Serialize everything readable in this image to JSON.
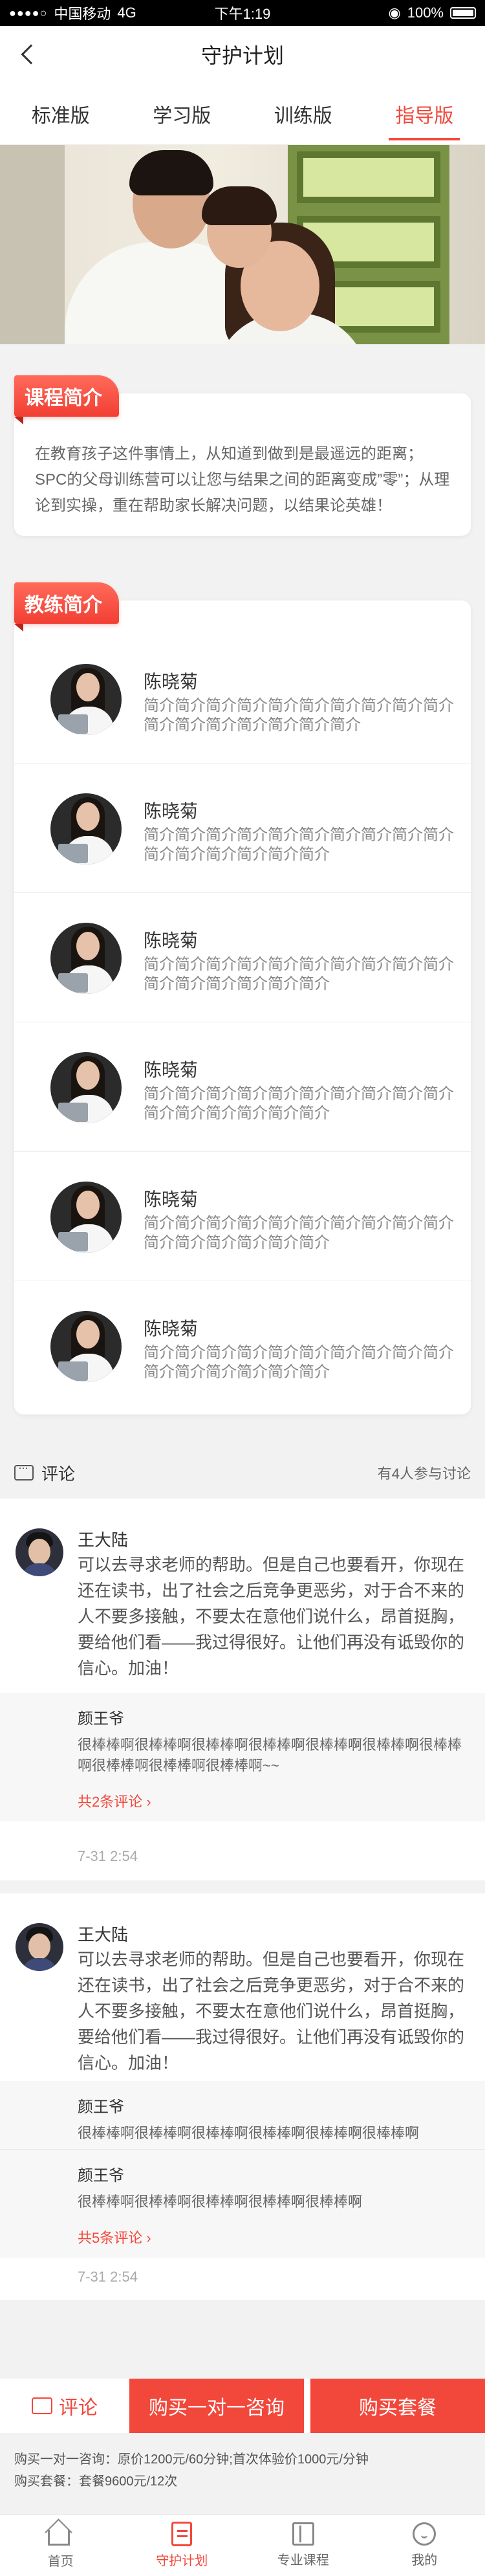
{
  "status_bar": {
    "carrier": "中国移动",
    "network": "4G",
    "time": "下午1:19",
    "battery": "100%"
  },
  "nav": {
    "title": "守护计划"
  },
  "tabs": [
    {
      "label": "标准版"
    },
    {
      "label": "学习版"
    },
    {
      "label": "训练版"
    },
    {
      "label": "指导版",
      "active": true
    }
  ],
  "course_intro": {
    "heading": "课程简介",
    "text": "在教育孩子这件事情上，从知道到做到是最遥远的距离；SPC的父母训练营可以让您与结果之间的距离变成”零”；从理论到实操，重在帮助家长解决问题，以结果论英雄！"
  },
  "coach_intro": {
    "heading": "教练简介",
    "coaches": [
      {
        "name": "陈晓菊",
        "desc": "简介简介简介简介简介简介简介简介简介简介简介简介简介简介简介简介简介"
      },
      {
        "name": "陈晓菊",
        "desc": "简介简介简介简介简介简介简介简介简介简介简介简介简介简介简介简介"
      },
      {
        "name": "陈晓菊",
        "desc": "简介简介简介简介简介简介简介简介简介简介简介简介简介简介简介简介"
      },
      {
        "name": "陈晓菊",
        "desc": "简介简介简介简介简介简介简介简介简介简介简介简介简介简介简介简介"
      },
      {
        "name": "陈晓菊",
        "desc": "简介简介简介简介简介简介简介简介简介简介简介简介简介简介简介简介"
      },
      {
        "name": "陈晓菊",
        "desc": "简介简介简介简介简介简介简介简介简介简介简介简介简介简介简介简介"
      }
    ]
  },
  "comments": {
    "label": "评论",
    "participants": "有4人参与讨论",
    "threads": [
      {
        "user": "王大陆",
        "text": "可以去寻求老师的帮助。但是自己也要看开，你现在还在读书，出了社会之后竞争更恶劣，对于合不来的人不要多接触，不要太在意他们说什么，昂首挺胸，要给他们看——我过得很好。让他们再没有诋毁你的信心。加油！",
        "replies": [
          {
            "user": "颜王爷",
            "text": "很棒棒啊很棒棒啊很棒棒啊很棒棒啊很棒棒啊很棒棒啊很棒棒啊很棒棒啊很棒棒啊很棒棒啊~~"
          }
        ],
        "more": "共2条评论",
        "time": "7-31  2:54"
      },
      {
        "user": "王大陆",
        "text": "可以去寻求老师的帮助。但是自己也要看开，你现在还在读书，出了社会之后竞争更恶劣，对于合不来的人不要多接触，不要太在意他们说什么，昂首挺胸，要给他们看——我过得很好。让他们再没有诋毁你的信心。加油！",
        "replies": [
          {
            "user": "颜王爷",
            "text": "很棒棒啊很棒棒啊很棒棒啊很棒棒啊很棒棒啊很棒棒啊"
          },
          {
            "user": "颜王爷",
            "text": "很棒棒啊很棒棒啊很棒棒啊很棒棒啊很棒棒啊"
          }
        ],
        "more": "共5条评论",
        "time": "7-31  2:54"
      }
    ]
  },
  "actions": {
    "comment": "评论",
    "consult": "购买一对一咨询",
    "package": "购买套餐"
  },
  "price": {
    "line1": "购买一对一咨询：原价1200元/60分钟;首次体验价1000元/分钟",
    "line2": "购买套餐：套餐9600元/12次"
  },
  "tab_bar": [
    {
      "label": "首页",
      "icon": "home-icon"
    },
    {
      "label": "守护计划",
      "icon": "plan-icon",
      "active": true
    },
    {
      "label": "专业课程",
      "icon": "course-icon"
    },
    {
      "label": "我的",
      "icon": "profile-icon"
    }
  ],
  "colors": {
    "accent": "#f2483c"
  }
}
